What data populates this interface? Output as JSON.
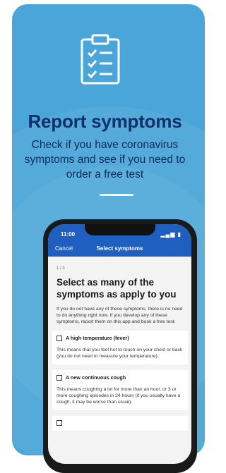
{
  "promo": {
    "title": "Report symptoms",
    "subtitle": "Check if you have coronavirus symptoms and see if you need to order a free test"
  },
  "phone": {
    "status_time": "11:00",
    "nav": {
      "cancel": "Cancel",
      "title": "Select symptoms"
    },
    "step": "1 / 3",
    "heading": "Select as many of the symptoms as apply to you",
    "intro": "If you do not have any of these symptoms, there is no need to do anything right now. If you develop any of these symptoms, report them on this app and book a free test.",
    "options": [
      {
        "label": "A high temperature (fever)",
        "description": "This means that you feel hot to touch on your chest or back (you do not need to measure your temperature)."
      },
      {
        "label": "A new continuous cough",
        "description": "This means coughing a lot for more than an hour, or 3 or more coughing episodes in 24 hours (if you usually have a cough, it may be worse than usual)."
      }
    ]
  },
  "colors": {
    "background": "#4aa6d8",
    "title": "#12306a",
    "nav_bar": "#1f5fbf"
  },
  "icons": {
    "top": "clipboard-checklist-icon"
  }
}
